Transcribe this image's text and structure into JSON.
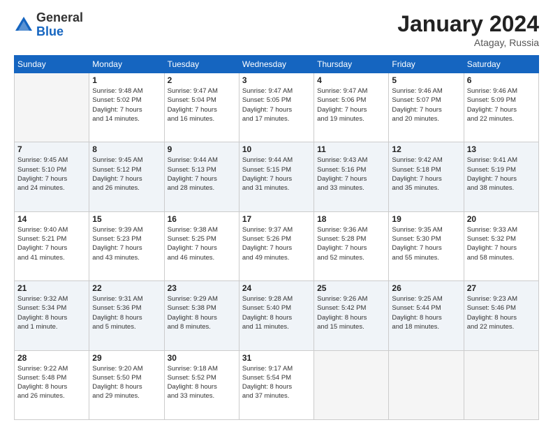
{
  "header": {
    "logo_general": "General",
    "logo_blue": "Blue",
    "month": "January 2024",
    "location": "Atagay, Russia"
  },
  "weekdays": [
    "Sunday",
    "Monday",
    "Tuesday",
    "Wednesday",
    "Thursday",
    "Friday",
    "Saturday"
  ],
  "weeks": [
    [
      {
        "day": "",
        "lines": [],
        "empty": true
      },
      {
        "day": "1",
        "lines": [
          "Sunrise: 9:48 AM",
          "Sunset: 5:02 PM",
          "Daylight: 7 hours",
          "and 14 minutes."
        ]
      },
      {
        "day": "2",
        "lines": [
          "Sunrise: 9:47 AM",
          "Sunset: 5:04 PM",
          "Daylight: 7 hours",
          "and 16 minutes."
        ]
      },
      {
        "day": "3",
        "lines": [
          "Sunrise: 9:47 AM",
          "Sunset: 5:05 PM",
          "Daylight: 7 hours",
          "and 17 minutes."
        ]
      },
      {
        "day": "4",
        "lines": [
          "Sunrise: 9:47 AM",
          "Sunset: 5:06 PM",
          "Daylight: 7 hours",
          "and 19 minutes."
        ]
      },
      {
        "day": "5",
        "lines": [
          "Sunrise: 9:46 AM",
          "Sunset: 5:07 PM",
          "Daylight: 7 hours",
          "and 20 minutes."
        ]
      },
      {
        "day": "6",
        "lines": [
          "Sunrise: 9:46 AM",
          "Sunset: 5:09 PM",
          "Daylight: 7 hours",
          "and 22 minutes."
        ]
      }
    ],
    [
      {
        "day": "7",
        "lines": [
          "Sunrise: 9:45 AM",
          "Sunset: 5:10 PM",
          "Daylight: 7 hours",
          "and 24 minutes."
        ]
      },
      {
        "day": "8",
        "lines": [
          "Sunrise: 9:45 AM",
          "Sunset: 5:12 PM",
          "Daylight: 7 hours",
          "and 26 minutes."
        ]
      },
      {
        "day": "9",
        "lines": [
          "Sunrise: 9:44 AM",
          "Sunset: 5:13 PM",
          "Daylight: 7 hours",
          "and 28 minutes."
        ]
      },
      {
        "day": "10",
        "lines": [
          "Sunrise: 9:44 AM",
          "Sunset: 5:15 PM",
          "Daylight: 7 hours",
          "and 31 minutes."
        ]
      },
      {
        "day": "11",
        "lines": [
          "Sunrise: 9:43 AM",
          "Sunset: 5:16 PM",
          "Daylight: 7 hours",
          "and 33 minutes."
        ]
      },
      {
        "day": "12",
        "lines": [
          "Sunrise: 9:42 AM",
          "Sunset: 5:18 PM",
          "Daylight: 7 hours",
          "and 35 minutes."
        ]
      },
      {
        "day": "13",
        "lines": [
          "Sunrise: 9:41 AM",
          "Sunset: 5:19 PM",
          "Daylight: 7 hours",
          "and 38 minutes."
        ]
      }
    ],
    [
      {
        "day": "14",
        "lines": [
          "Sunrise: 9:40 AM",
          "Sunset: 5:21 PM",
          "Daylight: 7 hours",
          "and 41 minutes."
        ]
      },
      {
        "day": "15",
        "lines": [
          "Sunrise: 9:39 AM",
          "Sunset: 5:23 PM",
          "Daylight: 7 hours",
          "and 43 minutes."
        ]
      },
      {
        "day": "16",
        "lines": [
          "Sunrise: 9:38 AM",
          "Sunset: 5:25 PM",
          "Daylight: 7 hours",
          "and 46 minutes."
        ]
      },
      {
        "day": "17",
        "lines": [
          "Sunrise: 9:37 AM",
          "Sunset: 5:26 PM",
          "Daylight: 7 hours",
          "and 49 minutes."
        ]
      },
      {
        "day": "18",
        "lines": [
          "Sunrise: 9:36 AM",
          "Sunset: 5:28 PM",
          "Daylight: 7 hours",
          "and 52 minutes."
        ]
      },
      {
        "day": "19",
        "lines": [
          "Sunrise: 9:35 AM",
          "Sunset: 5:30 PM",
          "Daylight: 7 hours",
          "and 55 minutes."
        ]
      },
      {
        "day": "20",
        "lines": [
          "Sunrise: 9:33 AM",
          "Sunset: 5:32 PM",
          "Daylight: 7 hours",
          "and 58 minutes."
        ]
      }
    ],
    [
      {
        "day": "21",
        "lines": [
          "Sunrise: 9:32 AM",
          "Sunset: 5:34 PM",
          "Daylight: 8 hours",
          "and 1 minute."
        ]
      },
      {
        "day": "22",
        "lines": [
          "Sunrise: 9:31 AM",
          "Sunset: 5:36 PM",
          "Daylight: 8 hours",
          "and 5 minutes."
        ]
      },
      {
        "day": "23",
        "lines": [
          "Sunrise: 9:29 AM",
          "Sunset: 5:38 PM",
          "Daylight: 8 hours",
          "and 8 minutes."
        ]
      },
      {
        "day": "24",
        "lines": [
          "Sunrise: 9:28 AM",
          "Sunset: 5:40 PM",
          "Daylight: 8 hours",
          "and 11 minutes."
        ]
      },
      {
        "day": "25",
        "lines": [
          "Sunrise: 9:26 AM",
          "Sunset: 5:42 PM",
          "Daylight: 8 hours",
          "and 15 minutes."
        ]
      },
      {
        "day": "26",
        "lines": [
          "Sunrise: 9:25 AM",
          "Sunset: 5:44 PM",
          "Daylight: 8 hours",
          "and 18 minutes."
        ]
      },
      {
        "day": "27",
        "lines": [
          "Sunrise: 9:23 AM",
          "Sunset: 5:46 PM",
          "Daylight: 8 hours",
          "and 22 minutes."
        ]
      }
    ],
    [
      {
        "day": "28",
        "lines": [
          "Sunrise: 9:22 AM",
          "Sunset: 5:48 PM",
          "Daylight: 8 hours",
          "and 26 minutes."
        ]
      },
      {
        "day": "29",
        "lines": [
          "Sunrise: 9:20 AM",
          "Sunset: 5:50 PM",
          "Daylight: 8 hours",
          "and 29 minutes."
        ]
      },
      {
        "day": "30",
        "lines": [
          "Sunrise: 9:18 AM",
          "Sunset: 5:52 PM",
          "Daylight: 8 hours",
          "and 33 minutes."
        ]
      },
      {
        "day": "31",
        "lines": [
          "Sunrise: 9:17 AM",
          "Sunset: 5:54 PM",
          "Daylight: 8 hours",
          "and 37 minutes."
        ]
      },
      {
        "day": "",
        "lines": [],
        "empty": true
      },
      {
        "day": "",
        "lines": [],
        "empty": true
      },
      {
        "day": "",
        "lines": [],
        "empty": true
      }
    ]
  ]
}
